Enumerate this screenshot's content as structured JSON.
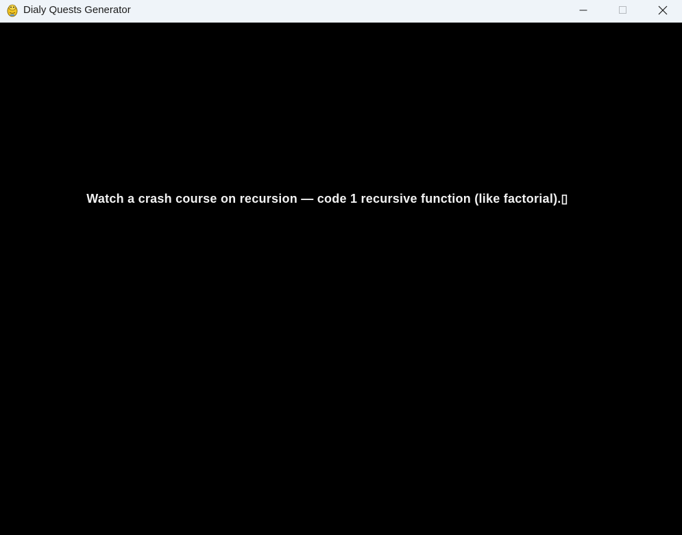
{
  "window": {
    "title": "Dialy Quests Generator",
    "icon": "pygame-snake-icon",
    "controls": {
      "minimize_icon": "minimize-icon",
      "maximize_icon": "maximize-icon",
      "close_icon": "close-icon"
    }
  },
  "canvas": {
    "background": "#000000",
    "quest_text": "Watch a crash course on recursion — code 1 recursive function (like factorial).▯",
    "text_color": "#f2f2f2"
  },
  "colors": {
    "titlebar": "#eff4f9",
    "title_text": "#1a1a1a"
  }
}
